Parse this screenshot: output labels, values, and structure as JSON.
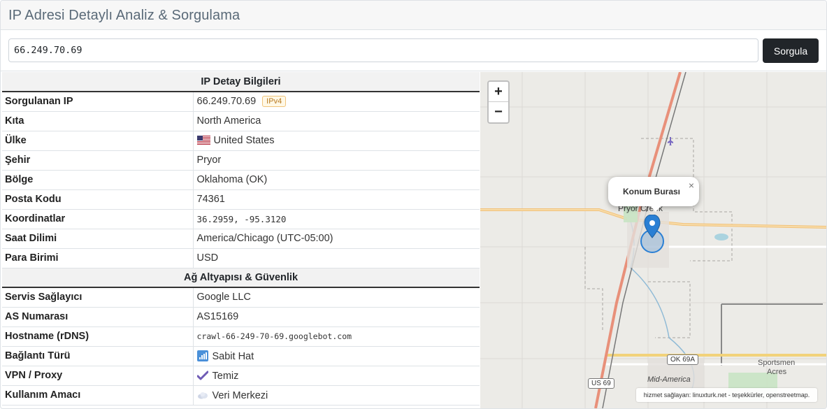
{
  "header": {
    "title": "IP Adresi Detaylı Analiz & Sorgulama"
  },
  "search": {
    "value": "66.249.70.69",
    "button_label": "Sorgula"
  },
  "sections": [
    {
      "title": "IP Detay Bilgileri",
      "rows": [
        {
          "label": "Sorgulanan IP",
          "value": "66.249.70.69",
          "badge": "IPv4"
        },
        {
          "label": "Kıta",
          "value": "North America"
        },
        {
          "label": "Ülke",
          "value": "United States",
          "icon": "us-flag-icon"
        },
        {
          "label": "Şehir",
          "value": "Pryor"
        },
        {
          "label": "Bölge",
          "value": "Oklahoma (OK)"
        },
        {
          "label": "Posta Kodu",
          "value": "74361"
        },
        {
          "label": "Koordinatlar",
          "value": "36.2959, -95.3120"
        },
        {
          "label": "Saat Dilimi",
          "value": "America/Chicago (UTC-05:00)"
        },
        {
          "label": "Para Birimi",
          "value": "USD"
        }
      ]
    },
    {
      "title": "Ağ Altyapısı & Güvenlik",
      "rows": [
        {
          "label": "Servis Sağlayıcı",
          "value": "Google LLC"
        },
        {
          "label": "AS Numarası",
          "value": "AS15169"
        },
        {
          "label": "Hostname (rDNS)",
          "value": "crawl-66-249-70-69.googlebot.com"
        },
        {
          "label": "Bağlantı Türü",
          "value": "Sabit Hat",
          "icon": "signal-bars-icon"
        },
        {
          "label": "VPN / Proxy",
          "value": "Temiz",
          "icon": "check-mark-icon"
        },
        {
          "label": "Kullanım Amacı",
          "value": "Veri Merkezi",
          "icon": "cloud-icon"
        }
      ]
    }
  ],
  "map": {
    "zoom_in": "+",
    "zoom_out": "−",
    "popup_text": "Konum Burası",
    "popup_close": "×",
    "city_label": "Pryor Creek",
    "label_sportsmen": "Sportsmen",
    "label_acres": "Acres",
    "label_mid_america": "Mid-America",
    "shield_ok69a": "OK 69A",
    "shield_us69": "US 69",
    "attribution": "hizmet sağlayan: linuxturk.net - teşekkürler, openstreetmap."
  },
  "colors": {
    "button_bg": "#212529",
    "marker": "#2a7fd4",
    "badge": "#b7791f"
  }
}
